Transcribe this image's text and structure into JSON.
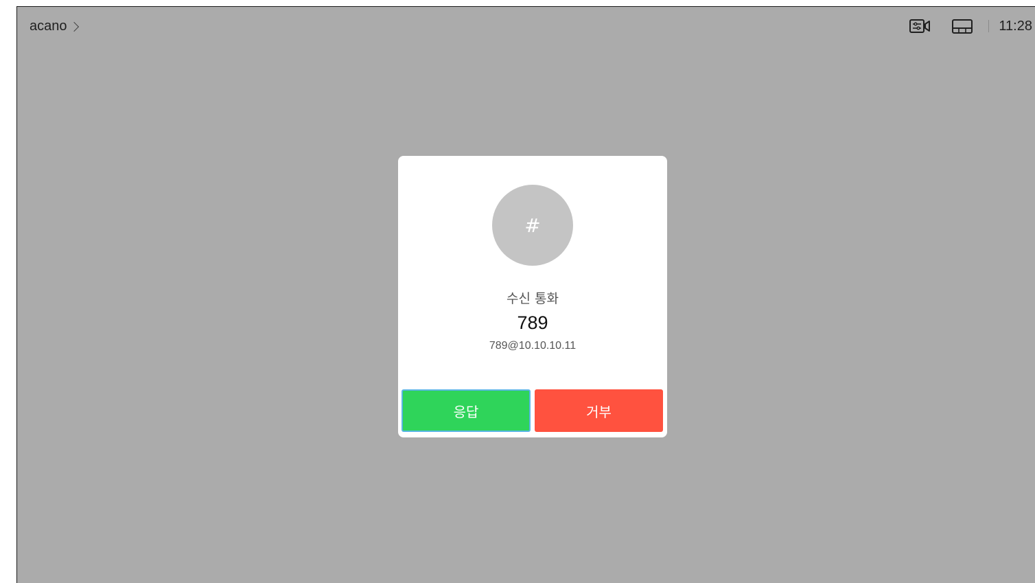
{
  "topbar": {
    "device_name": "acano",
    "chevron_icon": "chevron-right-icon",
    "camera_controls_icon": "camera-controls-icon",
    "layout_icon": "layout-icon",
    "clock": "11:28"
  },
  "incoming_call": {
    "avatar_symbol": "#",
    "title": "수신 통화",
    "caller_name": "789",
    "caller_uri": "789@10.10.10.11",
    "accept_label": "응답",
    "decline_label": "거부"
  },
  "colors": {
    "background": "#ababab",
    "accept": "#2fd45a",
    "decline": "#ff523f",
    "focus_outline": "#5ab6e4",
    "avatar": "#c4c4c4"
  }
}
